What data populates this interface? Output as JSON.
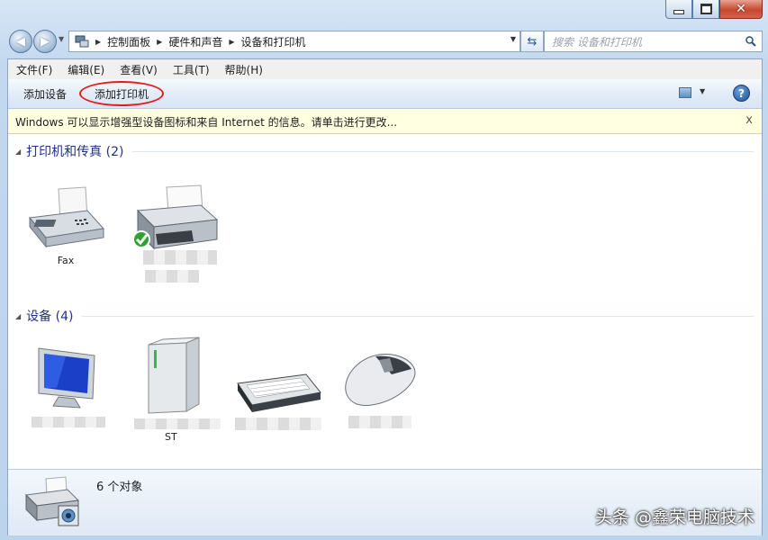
{
  "window": {
    "accent": "#c3d8ef"
  },
  "address_bar": {
    "crumbs": [
      "控制面板",
      "硬件和声音",
      "设备和打印机"
    ],
    "search_placeholder": "搜索 设备和打印机"
  },
  "menu": [
    "文件(F)",
    "编辑(E)",
    "查看(V)",
    "工具(T)",
    "帮助(H)"
  ],
  "toolbar": {
    "add_device": "添加设备",
    "add_printer": "添加打印机"
  },
  "info_bar": {
    "text": "Windows 可以显示增强型设备图标和来自 Internet 的信息。请单击进行更改...",
    "close": "x"
  },
  "groups": {
    "printers": {
      "title": "打印机和传真 (2)",
      "items": [
        {
          "label": "Fax",
          "icon": "fax-icon"
        },
        {
          "label": "",
          "icon": "printer-icon",
          "default": true
        }
      ]
    },
    "devices": {
      "title": "设备 (4)",
      "items": [
        {
          "label": "",
          "icon": "monitor-icon"
        },
        {
          "label": "ST",
          "icon": "drive-icon"
        },
        {
          "label": "",
          "icon": "keyboard-icon"
        },
        {
          "label": "",
          "icon": "mouse-icon"
        }
      ]
    }
  },
  "status": {
    "text": "6 个对象"
  },
  "watermark": "头条 @鑫荣电脑技术"
}
